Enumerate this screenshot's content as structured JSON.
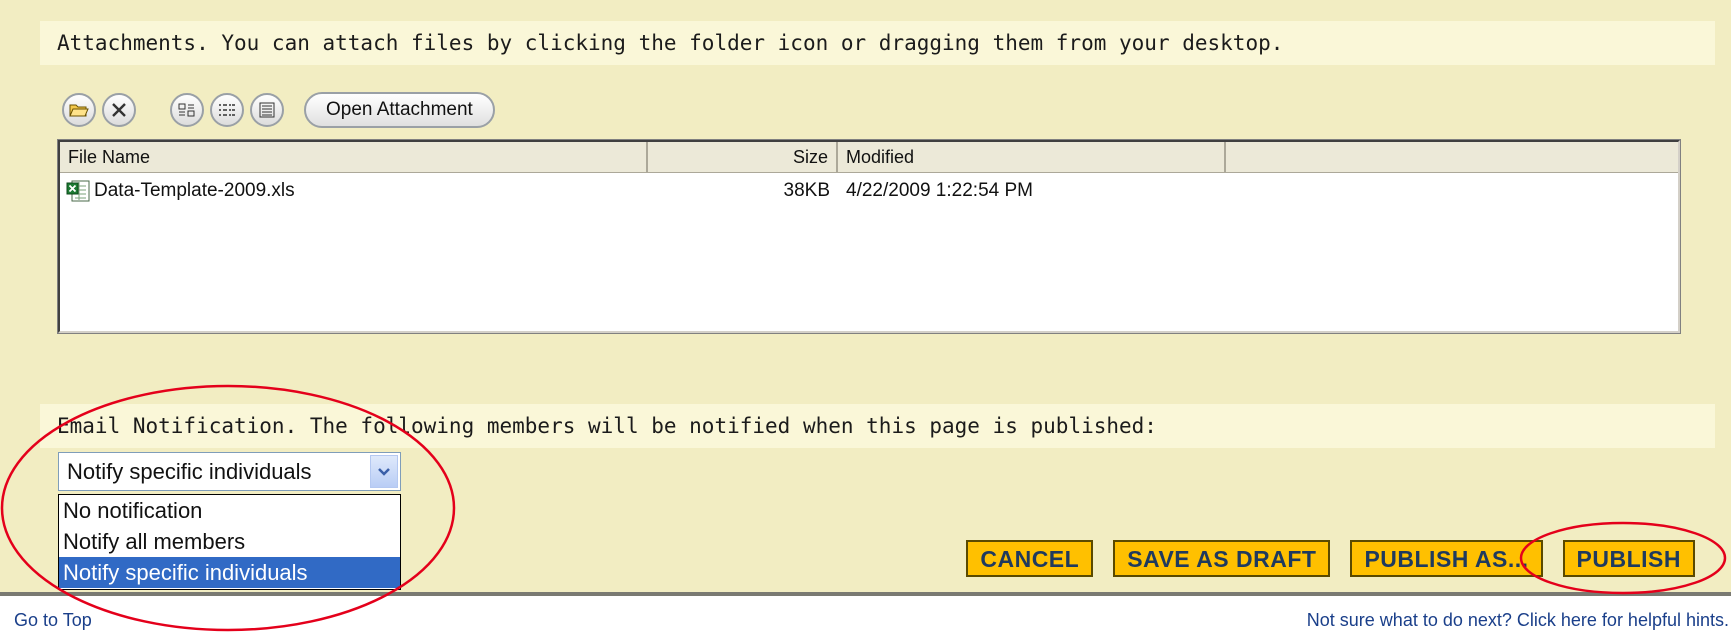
{
  "attachments": {
    "instructions": "Attachments. You can attach files by clicking the folder icon or dragging them from your desktop.",
    "toolbar": {
      "open_folder_icon": "folder-open-icon",
      "remove_icon": "remove-x-icon",
      "view_icons": [
        "small-icons-view-icon",
        "list-view-icon",
        "details-view-icon"
      ],
      "open_attachment_label": "Open Attachment"
    },
    "columns": [
      "File Name",
      "Size",
      "Modified",
      ""
    ],
    "files": [
      {
        "name": "Data-Template-2009.xls",
        "size": "38KB",
        "modified": "4/22/2009 1:22:54 PM"
      }
    ]
  },
  "email": {
    "instructions": "Email Notification. The following members will be notified when this page is published:",
    "selected": "Notify specific individuals",
    "options": [
      "No notification",
      "Notify all members",
      "Notify specific individuals"
    ]
  },
  "actions": {
    "cancel": "CANCEL",
    "save_draft": "SAVE AS DRAFT",
    "publish_as": "PUBLISH AS...",
    "publish": "PUBLISH"
  },
  "footer": {
    "go_to_top": "Go to Top",
    "hint": "Not sure what to do next? Click here for helpful hints."
  },
  "colors": {
    "panel": "#f2edc2",
    "band": "#faf7d8",
    "button": "#ffc000",
    "button_text": "#1f3a5e",
    "annotation": "#e4001b",
    "selection": "#316ac5"
  }
}
